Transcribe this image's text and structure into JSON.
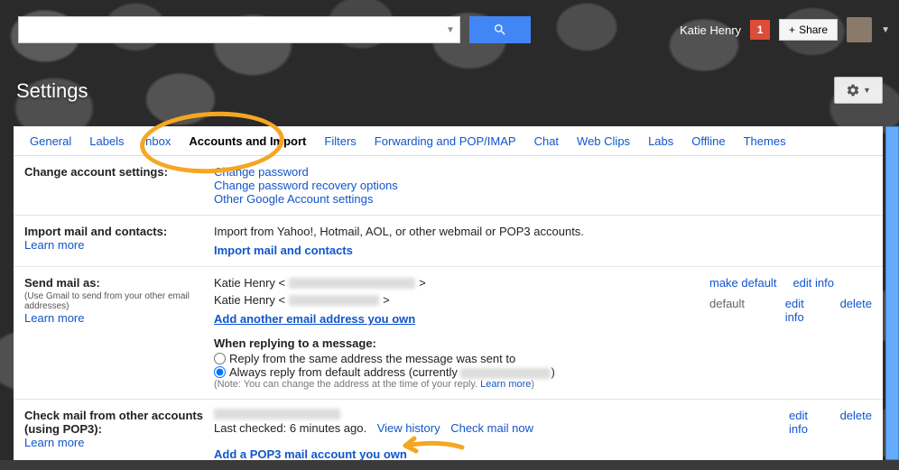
{
  "topbar": {
    "search_placeholder": "",
    "username": "Katie Henry",
    "notif_count": "1",
    "share_label": "Share"
  },
  "page_title": "Settings",
  "tabs": [
    "General",
    "Labels",
    "Inbox",
    "Accounts and Import",
    "Filters",
    "Forwarding and POP/IMAP",
    "Chat",
    "Web Clips",
    "Labs",
    "Offline",
    "Themes"
  ],
  "sections": {
    "change_account": {
      "title": "Change account settings:",
      "links": [
        "Change password",
        "Change password recovery options",
        "Other Google Account settings"
      ]
    },
    "import_mail": {
      "title": "Import mail and contacts:",
      "learn_more": "Learn more",
      "desc": "Import from Yahoo!, Hotmail, AOL, or other webmail or POP3 accounts.",
      "action": "Import mail and contacts"
    },
    "send_as": {
      "title": "Send mail as:",
      "subtitle": "(Use Gmail to send from your other email addresses)",
      "learn_more": "Learn more",
      "name1": "Katie Henry <",
      "close1": ">",
      "name2": "Katie Henry <",
      "close2": ">",
      "make_default": "make default",
      "edit_info": "edit info",
      "default_label": "default",
      "delete": "delete",
      "add_another": "Add another email address you own",
      "reply_heading": "When replying to a message:",
      "reply_opt1": "Reply from the same address the message was sent to",
      "reply_opt2_a": "Always reply from default address (currently ",
      "reply_opt2_b": ")",
      "note_a": "(Note: You can change the address at the time of your reply. ",
      "note_b": ")",
      "note_link": "Learn more"
    },
    "pop3": {
      "title": "Check mail from other accounts (using POP3):",
      "learn_more": "Learn more",
      "last_checked": "Last checked: 6 minutes ago.",
      "view_history": "View history",
      "check_now": "Check mail now",
      "edit_info": "edit info",
      "delete": "delete",
      "add_action": "Add a POP3 mail account you own"
    }
  }
}
